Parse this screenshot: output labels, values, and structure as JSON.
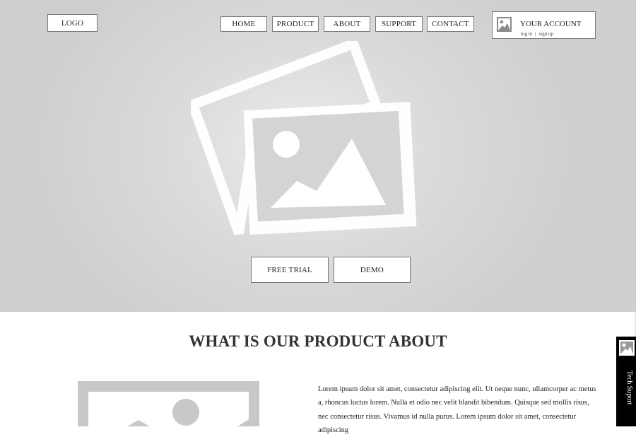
{
  "header": {
    "logo_label": "LOGO",
    "nav": {
      "home": "HOME",
      "product": "PRODUCT",
      "about": "ABOUT",
      "support": "SUPPORT",
      "contact": "CONTACT"
    },
    "account": {
      "title": "YOUR ACCOUNT",
      "login": "log in",
      "separator": "|",
      "signup": "sign up"
    }
  },
  "hero": {
    "icon": "image-placeholder-icon",
    "buttons": {
      "free_trial": "FREE TRIAL",
      "demo": "DEMO"
    }
  },
  "section": {
    "title": "WHAT IS OUR PRODUCT ABOUT",
    "image_icon": "image-placeholder-icon",
    "body": "Lorem ipsum dolor sit amet, consectetur adipiscing elit. Ut neque nunc, ullamcorper ac metus a, rhoncus luctus lorem. Nulla et odio nec velit blandit bibendum. Quisque sed mollis risus, nec consectetur risus. Vivamus id nulla purus. Lorem ipsum dolor sit amet, consectetur adipiscing"
  },
  "tech_support": {
    "label": "Tech Suport",
    "icon": "image-placeholder-icon"
  },
  "colors": {
    "hero_bg": "#d6d6d6",
    "button_bg": "#ffffff",
    "button_border": "#7a7a7a",
    "tech_bg": "#000000"
  }
}
